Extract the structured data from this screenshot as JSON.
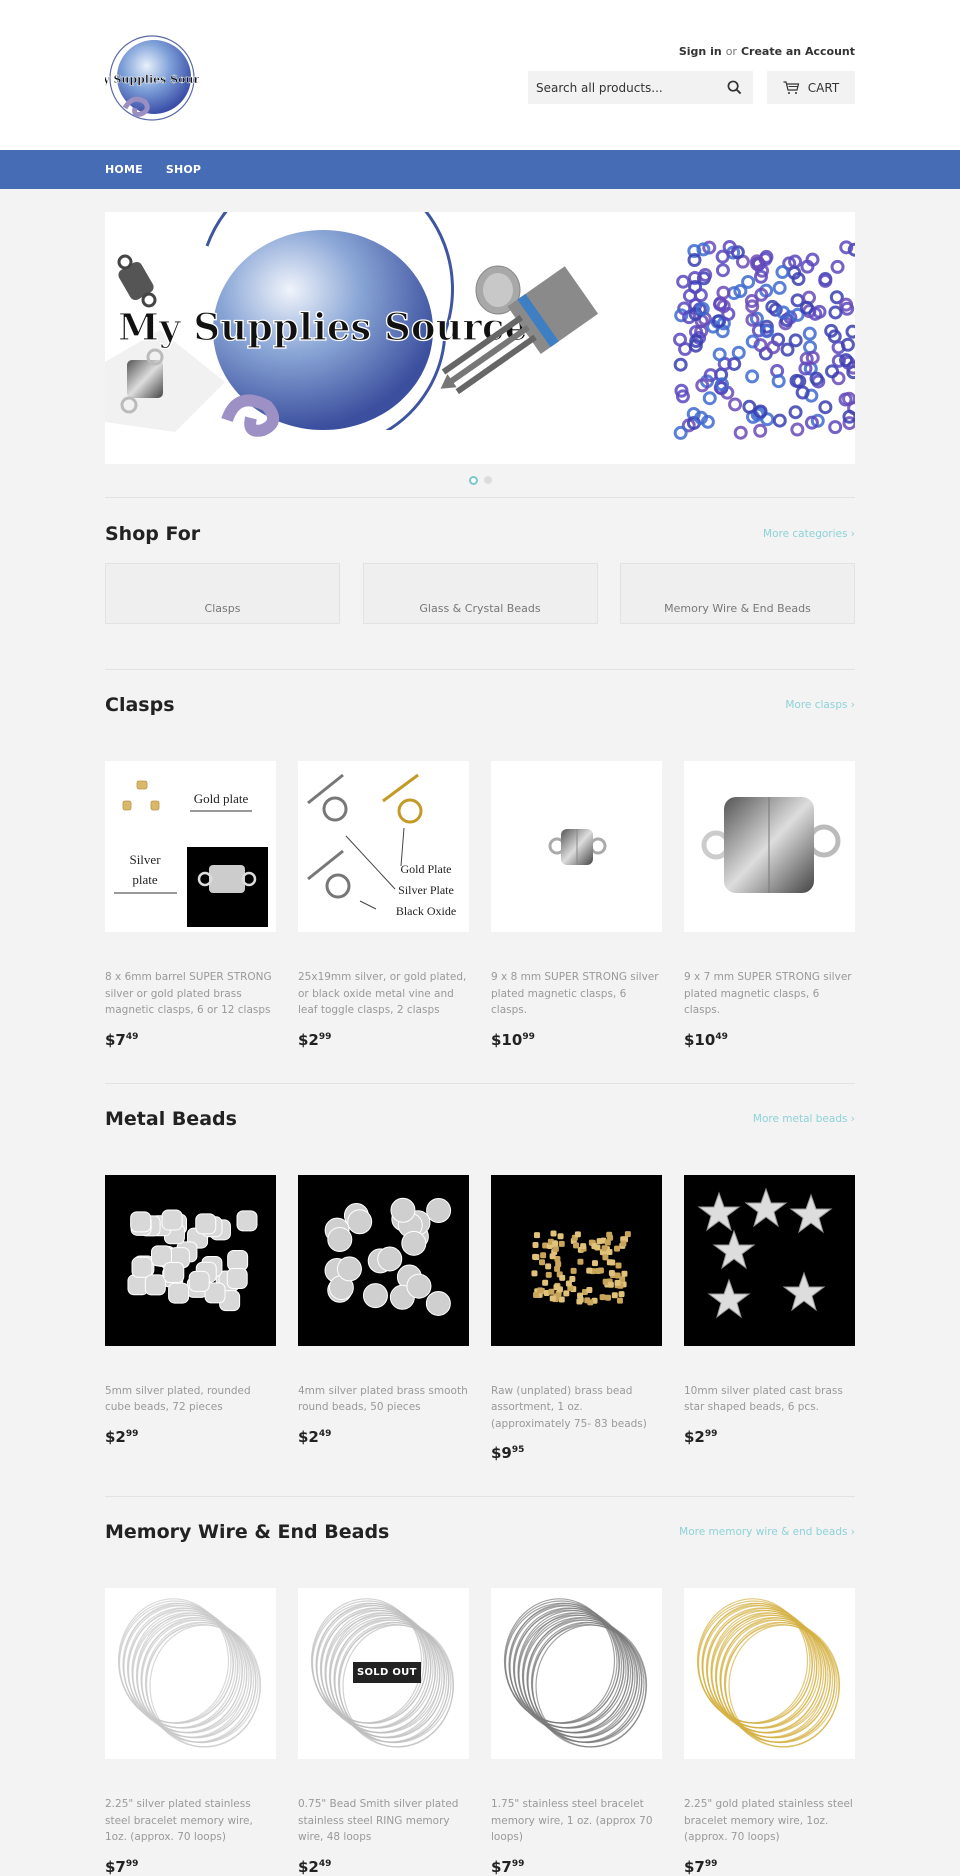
{
  "header": {
    "logo_alt": "My Supplies Source",
    "sign_in": "Sign in",
    "or": "or",
    "create_account": "Create an Account",
    "search_placeholder": "Search all products...",
    "cart_label": "CART"
  },
  "nav": {
    "items": [
      {
        "label": "HOME"
      },
      {
        "label": "SHOP"
      }
    ]
  },
  "slideshow": {
    "banner_text": "My Supplies Source",
    "slide_count": 2,
    "active_slide": 1
  },
  "shop_for": {
    "title": "Shop For",
    "more_link": "More categories ›",
    "collections": [
      {
        "label": "Clasps"
      },
      {
        "label": "Glass & Crystal Beads"
      },
      {
        "label": "Memory Wire & End Beads"
      }
    ]
  },
  "sections": [
    {
      "title": "Clasps",
      "more_link": "More clasps ›",
      "products": [
        {
          "title": "8 x 6mm barrel SUPER STRONG silver or gold plated brass magnetic clasps, 6 or 12 clasps",
          "price_dollars": "$7",
          "price_cents": "49",
          "image_labels": [
            "Gold plate",
            "Silver plate"
          ]
        },
        {
          "title": "25x19mm silver, or gold plated, or black oxide metal vine and leaf toggle clasps, 2 clasps",
          "price_dollars": "$2",
          "price_cents": "99",
          "image_labels": [
            "Gold Plate",
            "Silver Plate",
            "Black Oxide"
          ]
        },
        {
          "title": "9 x 8 mm SUPER STRONG silver plated magnetic clasps, 6 clasps.",
          "price_dollars": "$10",
          "price_cents": "99"
        },
        {
          "title": "9 x 7 mm SUPER STRONG silver plated magnetic clasps, 6 clasps.",
          "price_dollars": "$10",
          "price_cents": "49"
        }
      ]
    },
    {
      "title": "Metal Beads",
      "more_link": "More metal beads ›",
      "products": [
        {
          "title": "5mm silver plated, rounded cube beads, 72 pieces",
          "price_dollars": "$2",
          "price_cents": "99"
        },
        {
          "title": "4mm silver plated brass smooth round beads, 50 pieces",
          "price_dollars": "$2",
          "price_cents": "49"
        },
        {
          "title": "Raw (unplated) brass bead assortment, 1 oz. (approximately 75- 83 beads)",
          "price_dollars": "$9",
          "price_cents": "95"
        },
        {
          "title": "10mm silver plated cast brass star shaped beads, 6 pcs.",
          "price_dollars": "$2",
          "price_cents": "99"
        }
      ]
    },
    {
      "title": "Memory Wire & End Beads",
      "more_link": "More memory wire & end beads ›",
      "products": [
        {
          "title": "2.25\" silver plated stainless steel bracelet memory wire, 1oz. (approx. 70 loops)",
          "price_dollars": "$7",
          "price_cents": "99"
        },
        {
          "title": "0.75\" Bead Smith silver plated stainless steel RING memory wire, 48 loops",
          "price_dollars": "$2",
          "price_cents": "49",
          "badge": "SOLD OUT"
        },
        {
          "title": "1.75\" stainless steel bracelet memory wire, 1 oz. (approx 70 loops)",
          "price_dollars": "$7",
          "price_cents": "99"
        },
        {
          "title": "2.25\" gold plated stainless steel bracelet memory wire, 1oz. (approx. 70 loops)",
          "price_dollars": "$7",
          "price_cents": "99"
        }
      ]
    }
  ],
  "colors": {
    "nav_bg": "#456cb5",
    "accent_link": "#8ed2d8",
    "page_bg": "#f3f3f3"
  }
}
